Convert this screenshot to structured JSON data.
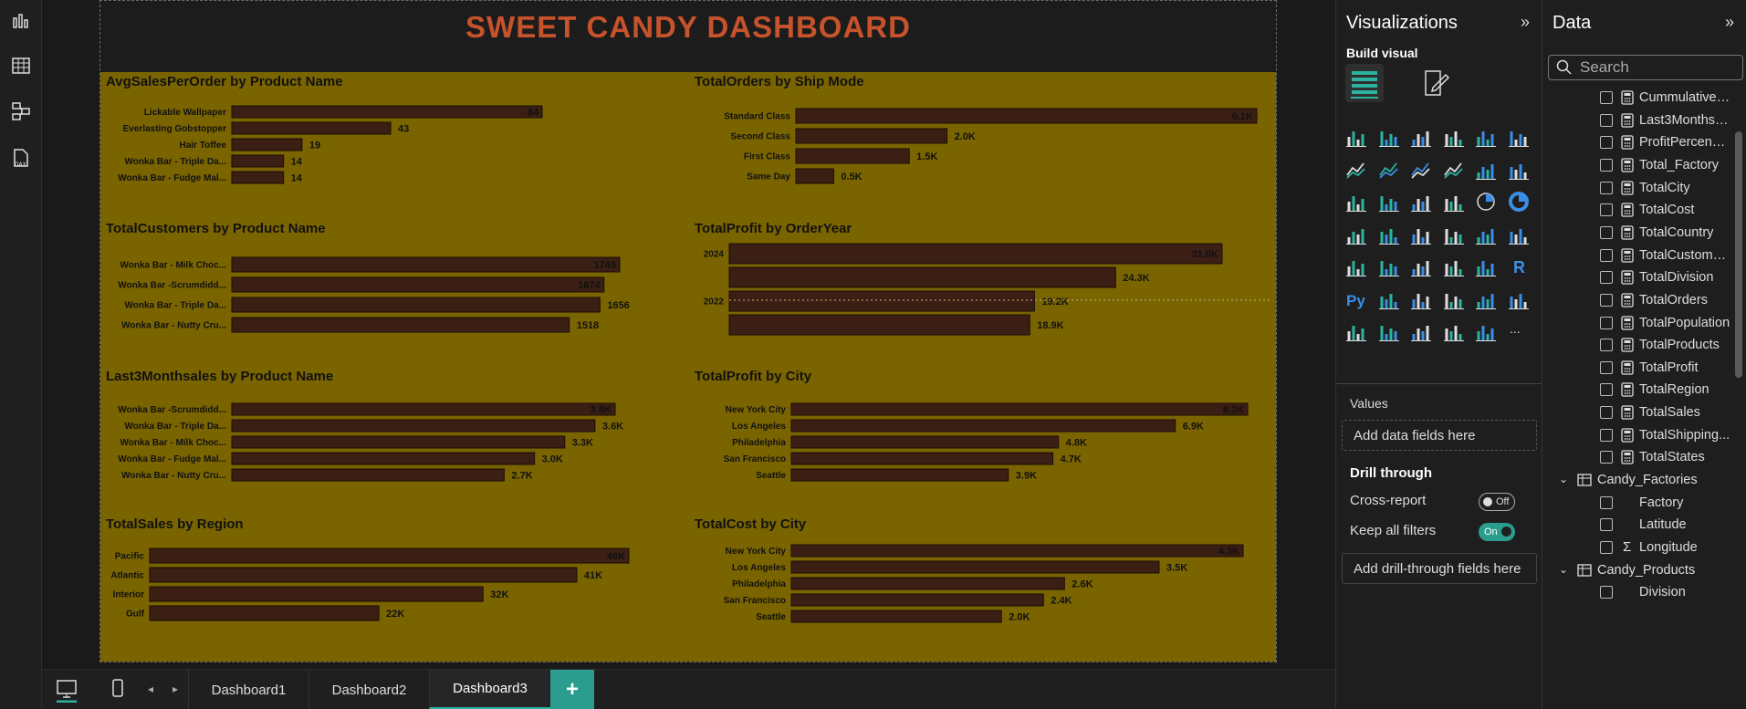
{
  "report": {
    "title": "SWEET CANDY DASHBOARD",
    "colors": {
      "title": "#c6532b",
      "panel": "#7a6400",
      "bar": "#3b1e14",
      "bar_stroke": "#1a0d08",
      "text": "#111111"
    }
  },
  "pages": {
    "tabs": [
      {
        "label": "Dashboard1",
        "active": false
      },
      {
        "label": "Dashboard2",
        "active": false
      },
      {
        "label": "Dashboard3",
        "active": true
      }
    ],
    "add_label": "+"
  },
  "chart_data": [
    {
      "type": "bar",
      "orientation": "horizontal",
      "title": "AvgSalesPerOrder by Product Name",
      "categories": [
        "Lickable Wallpaper",
        "Everlasting Gobstopper",
        "Hair Toffee",
        "Wonka Bar - Triple Da...",
        "Wonka Bar - Fudge Mal..."
      ],
      "values": [
        84,
        43,
        19,
        14,
        14
      ],
      "labels": [
        "84",
        "43",
        "19",
        "14",
        "14"
      ]
    },
    {
      "type": "bar",
      "orientation": "horizontal",
      "title": "TotalOrders by Ship Mode",
      "categories": [
        "Standard Class",
        "Second Class",
        "First Class",
        "Same Day"
      ],
      "values": [
        6100,
        2000,
        1500,
        500
      ],
      "labels": [
        "6.1K",
        "2.0K",
        "1.5K",
        "0.5K"
      ]
    },
    {
      "type": "bar",
      "orientation": "horizontal",
      "title": "TotalCustomers by Product Name",
      "categories": [
        "Wonka Bar - Milk Choc...",
        "Wonka Bar -Scrumdidd...",
        "Wonka Bar - Triple Da...",
        "Wonka Bar - Nutty Cru..."
      ],
      "values": [
        1745,
        1674,
        1656,
        1518
      ],
      "labels": [
        "1745",
        "1674",
        "1656",
        "1518"
      ]
    },
    {
      "type": "bar",
      "orientation": "horizontal",
      "title": "TotalProfit by OrderYear",
      "categories": [
        "2024",
        "",
        "2022",
        ""
      ],
      "values": [
        31000,
        24300,
        19200,
        18900
      ],
      "labels": [
        "31.0K",
        "24.3K",
        "19.2K",
        "18.9K"
      ]
    },
    {
      "type": "bar",
      "orientation": "horizontal",
      "title": "Last3Monthsales by Product Name",
      "categories": [
        "Wonka Bar -Scrumdidd...",
        "Wonka Bar - Triple Da...",
        "Wonka Bar - Milk Choc...",
        "Wonka Bar - Fudge Mal...",
        "Wonka Bar - Nutty Cru..."
      ],
      "values": [
        3800,
        3600,
        3300,
        3000,
        2700
      ],
      "labels": [
        "3.8K",
        "3.6K",
        "3.3K",
        "3.0K",
        "2.7K"
      ]
    },
    {
      "type": "bar",
      "orientation": "horizontal",
      "title": "TotalProfit by City",
      "categories": [
        "New York City",
        "Los Angeles",
        "Philadelphia",
        "San Francisco",
        "Seattle"
      ],
      "values": [
        8200,
        6900,
        4800,
        4700,
        3900
      ],
      "labels": [
        "8.2K",
        "6.9K",
        "4.8K",
        "4.7K",
        "3.9K"
      ]
    },
    {
      "type": "bar",
      "orientation": "horizontal",
      "title": "TotalSales by Region",
      "categories": [
        "Pacific",
        "Atlantic",
        "Interior",
        "Gulf"
      ],
      "values": [
        46000,
        41000,
        32000,
        22000
      ],
      "labels": [
        "46K",
        "41K",
        "32K",
        "22K"
      ]
    },
    {
      "type": "bar",
      "orientation": "horizontal",
      "title": "TotalCost by City",
      "categories": [
        "New York City",
        "Los Angeles",
        "Philadelphia",
        "San Francisco",
        "Seattle"
      ],
      "values": [
        4300,
        3500,
        2600,
        2400,
        2000
      ],
      "labels": [
        "4.3K",
        "3.5K",
        "2.6K",
        "2.4K",
        "2.0K"
      ]
    }
  ],
  "visualizations": {
    "title": "Visualizations",
    "collapse": "»",
    "build_visual": "Build visual",
    "more": "...",
    "values_label": "Values",
    "values_placeholder": "Add data fields here",
    "drill_through": "Drill through",
    "cross_report_label": "Cross-report",
    "cross_report_state": "Off",
    "keep_filters_label": "Keep all filters",
    "keep_filters_state": "On",
    "drill_placeholder": "Add drill-through fields here"
  },
  "data_pane": {
    "title": "Data",
    "collapse": "»",
    "search_placeholder": "Search",
    "fields": [
      {
        "name": "CummulativeY...",
        "kind": "measure"
      },
      {
        "name": "Last3Monthsal...",
        "kind": "measure"
      },
      {
        "name": "ProfitPercenat...",
        "kind": "measure"
      },
      {
        "name": "Total_Factory",
        "kind": "measure"
      },
      {
        "name": "TotalCity",
        "kind": "measure"
      },
      {
        "name": "TotalCost",
        "kind": "measure"
      },
      {
        "name": "TotalCountry",
        "kind": "measure"
      },
      {
        "name": "TotalCustomers",
        "kind": "measure"
      },
      {
        "name": "TotalDivision",
        "kind": "measure"
      },
      {
        "name": "TotalOrders",
        "kind": "measure"
      },
      {
        "name": "TotalPopulation",
        "kind": "measure"
      },
      {
        "name": "TotalProducts",
        "kind": "measure"
      },
      {
        "name": "TotalProfit",
        "kind": "measure"
      },
      {
        "name": "TotalRegion",
        "kind": "measure"
      },
      {
        "name": "TotalSales",
        "kind": "measure"
      },
      {
        "name": "TotalShipping...",
        "kind": "measure"
      },
      {
        "name": "TotalStates",
        "kind": "measure"
      },
      {
        "name": "Candy_Factories",
        "kind": "table"
      },
      {
        "name": "Factory",
        "kind": "column"
      },
      {
        "name": "Latitude",
        "kind": "column"
      },
      {
        "name": "Longitude",
        "kind": "sum"
      },
      {
        "name": "Candy_Products",
        "kind": "table"
      },
      {
        "name": "Division",
        "kind": "column"
      }
    ]
  }
}
